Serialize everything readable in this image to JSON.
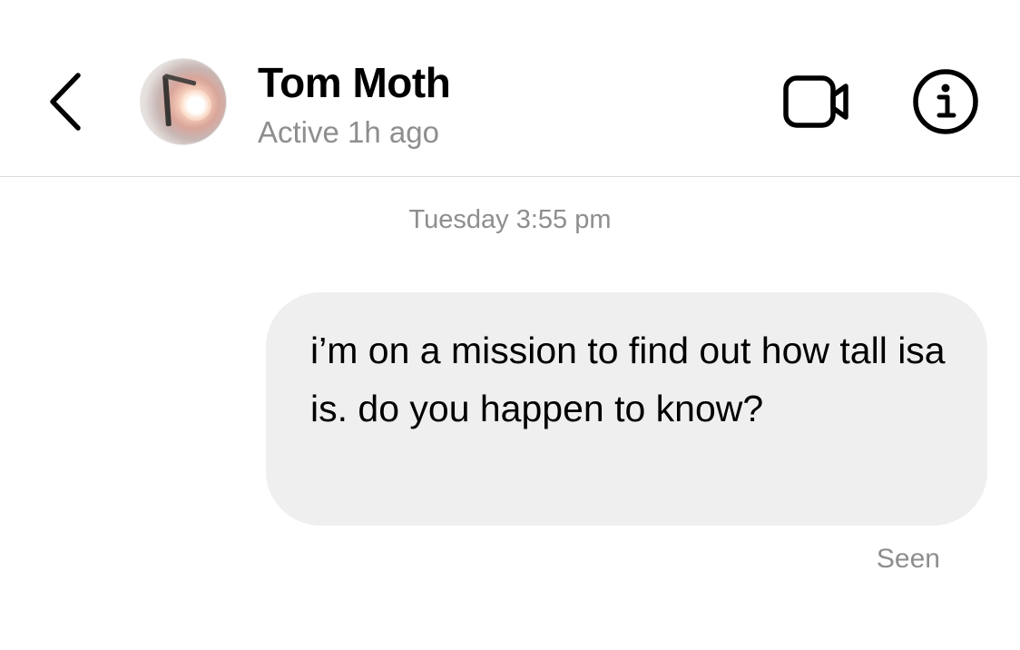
{
  "header": {
    "back_icon": "chevron-left-icon",
    "contact_name": "Tom Moth",
    "status": "Active 1h ago",
    "video_icon": "video-camera-icon",
    "info_icon": "info-icon"
  },
  "conversation": {
    "timestamp": "Tuesday 3:55 pm",
    "messages": [
      {
        "sender": "me",
        "text": "i’m on a mission to find out how tall isa is. do you happen to know?"
      }
    ],
    "read_receipt": "Seen"
  },
  "colors": {
    "bubble_background": "#efefef",
    "secondary_text": "#8e8e8e",
    "divider": "#dbdbdb",
    "primary_text": "#000000"
  }
}
